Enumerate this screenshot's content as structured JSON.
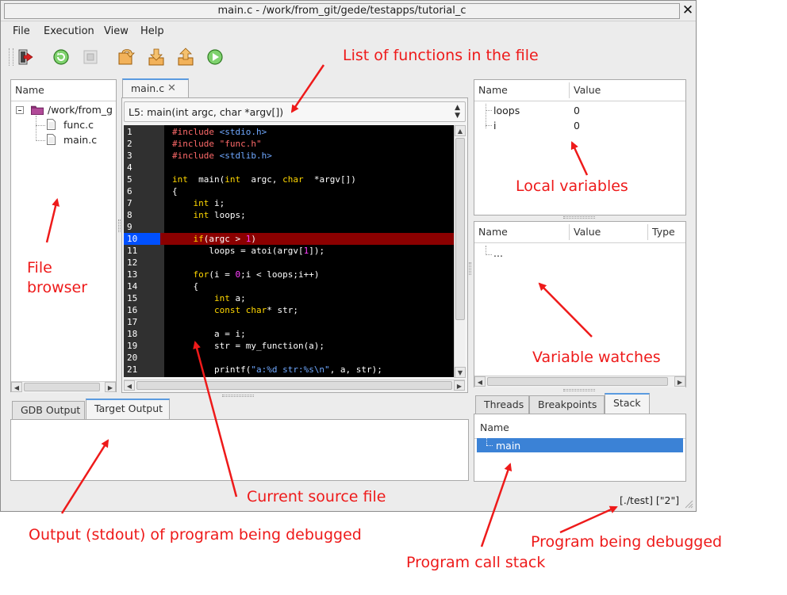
{
  "window": {
    "title": "main.c - /work/from_git/gede/testapps/tutorial_c"
  },
  "menu": [
    "File",
    "Execution",
    "View",
    "Help"
  ],
  "toolbar": {
    "buttons": [
      "exit-icon",
      "restart-icon",
      "stop-icon",
      "step-over-icon",
      "step-into-icon",
      "step-out-icon",
      "continue-icon"
    ]
  },
  "file_browser": {
    "header": "Name",
    "root": "/work/from_g",
    "files": [
      "func.c",
      "main.c"
    ]
  },
  "editor": {
    "tab": "main.c",
    "function_combo": "L5: main(int argc, char *argv[])",
    "current_line": 10,
    "lines": [
      {
        "n": "1",
        "t": [
          [
            "pp",
            "#include "
          ],
          [
            "inc",
            "<stdio.h>"
          ]
        ]
      },
      {
        "n": "2",
        "t": [
          [
            "pp",
            "#include "
          ],
          [
            "pp",
            "\"func.h\""
          ]
        ]
      },
      {
        "n": "3",
        "t": [
          [
            "pp",
            "#include "
          ],
          [
            "inc",
            "<stdlib.h>"
          ]
        ]
      },
      {
        "n": "4",
        "t": []
      },
      {
        "n": "5",
        "t": [
          [
            "kw",
            "int"
          ],
          [
            "",
            "  main("
          ],
          [
            "kw",
            "int"
          ],
          [
            "",
            "  argc, "
          ],
          [
            "kw",
            "char"
          ],
          [
            "",
            "  *argv[])"
          ]
        ]
      },
      {
        "n": "6",
        "t": [
          [
            "",
            "{"
          ]
        ]
      },
      {
        "n": "7",
        "t": [
          [
            "",
            "    "
          ],
          [
            "kw",
            "int"
          ],
          [
            "",
            " i;"
          ]
        ]
      },
      {
        "n": "8",
        "t": [
          [
            "",
            "    "
          ],
          [
            "kw",
            "int"
          ],
          [
            "",
            " loops;"
          ]
        ]
      },
      {
        "n": "9",
        "t": []
      },
      {
        "n": "10",
        "t": [
          [
            "",
            "    "
          ],
          [
            "kw",
            "if"
          ],
          [
            "",
            "(argc > "
          ],
          [
            "num",
            "1"
          ],
          [
            "",
            ")"
          ]
        ]
      },
      {
        "n": "11",
        "t": [
          [
            "",
            "       loops = atoi(argv["
          ],
          [
            "num",
            "1"
          ],
          [
            "",
            "]);"
          ]
        ]
      },
      {
        "n": "12",
        "t": []
      },
      {
        "n": "13",
        "t": [
          [
            "",
            "    "
          ],
          [
            "kw",
            "for"
          ],
          [
            "",
            "(i = "
          ],
          [
            "num",
            "0"
          ],
          [
            "",
            ";i < loops;i++)"
          ]
        ]
      },
      {
        "n": "14",
        "t": [
          [
            "",
            "    {"
          ]
        ]
      },
      {
        "n": "15",
        "t": [
          [
            "",
            "        "
          ],
          [
            "kw",
            "int"
          ],
          [
            "",
            " a;"
          ]
        ]
      },
      {
        "n": "16",
        "t": [
          [
            "",
            "        "
          ],
          [
            "kw",
            "const"
          ],
          [
            "",
            ""
          ],
          [
            "kw",
            " char"
          ],
          [
            "",
            "* str;"
          ]
        ]
      },
      {
        "n": "17",
        "t": []
      },
      {
        "n": "18",
        "t": [
          [
            "",
            "        a = i;"
          ]
        ]
      },
      {
        "n": "19",
        "t": [
          [
            "",
            "        str = my_function(a);"
          ]
        ]
      },
      {
        "n": "20",
        "t": []
      },
      {
        "n": "21",
        "t": [
          [
            "",
            "        printf("
          ],
          [
            "str",
            "\"a:%d str:%s\\n\""
          ],
          [
            "",
            ", a, str);"
          ]
        ]
      }
    ]
  },
  "output": {
    "tabs": [
      "GDB Output",
      "Target Output"
    ],
    "active": "Target Output",
    "content": ""
  },
  "locals": {
    "headers": [
      "Name",
      "Value"
    ],
    "rows": [
      {
        "name": "loops",
        "value": "0"
      },
      {
        "name": "i",
        "value": "0"
      }
    ]
  },
  "watches": {
    "headers": [
      "Name",
      "Value",
      "Type"
    ],
    "rows": [
      {
        "name": "...",
        "value": "",
        "type": ""
      }
    ]
  },
  "stack_panel": {
    "tabs": [
      "Threads",
      "Breakpoints",
      "Stack"
    ],
    "active": "Stack",
    "header": "Name",
    "frames": [
      "main"
    ]
  },
  "status": {
    "program": "[./test] [\"2\"]"
  },
  "annotations": {
    "functions": "List of functions in the file",
    "locals": "Local variables",
    "file_browser_1": "File",
    "file_browser_2": "browser",
    "watches": "Variable watches",
    "source": "Current source file",
    "output": "Output (stdout) of program being debugged",
    "program": "Program being debugged",
    "stack": "Program call stack"
  },
  "colors": {
    "annotation": "#ee1a1a",
    "current_line_bg": "#8b0000",
    "current_line_num_bg": "#0050ff",
    "selection": "#3b82d6"
  }
}
